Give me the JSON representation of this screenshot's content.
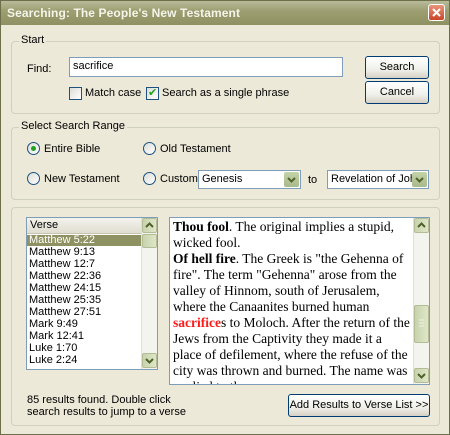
{
  "window": {
    "title": "Searching: The People's New Testament"
  },
  "start": {
    "group_label": "Start",
    "find_label": "Find:",
    "find_value": "sacrifice",
    "search_button": "Search",
    "cancel_button": "Cancel",
    "match_case_label": "Match case",
    "match_case_checked": false,
    "single_phrase_label": "Search as a single phrase",
    "single_phrase_checked": true,
    "check_mark": "✔"
  },
  "range": {
    "group_label": "Select Search Range",
    "entire_bible": "Entire Bible",
    "old_testament": "Old Testament",
    "new_testament": "New Testament",
    "custom": "Custom",
    "selected": "entire_bible",
    "from_value": "Genesis",
    "to_label": "to",
    "to_value": "Revelation of John"
  },
  "results": {
    "column_header": "Verse",
    "verses": [
      "Matthew 5:22",
      "Matthew 9:13",
      "Matthew 12:7",
      "Matthew 22:36",
      "Matthew 24:15",
      "Matthew 25:35",
      "Matthew 27:51",
      "Mark 9:49",
      "Mark 12:41",
      "Luke 1:70",
      "Luke 2:24"
    ],
    "selected_index": 0,
    "status_line1": "85 results found. Double click",
    "status_line2": "search results to jump to a verse",
    "add_button": "Add Results to Verse List >>"
  },
  "commentary": {
    "p1_bold": "Thou fool",
    "p1_rest": ". The original implies a stupid, wicked fool.",
    "p2_bold": "Of hell fire",
    "p2_before": ". The Greek is \"the Gehenna of fire\". The term \"Gehenna\" arose from the valley of Hinnom, south of Jerusalem, where the Canaanites burned human ",
    "p2_highlight": "sacrifice",
    "p2_after": "s to Moloch. After the return of the Jews from the Captivity they made it a place of defilement, where the refuse of the city was thrown and burned. The name was applied to the"
  },
  "colors": {
    "highlight": "#ff1a1a",
    "selection": "#8e9162",
    "title_bar": "#9d9f72"
  }
}
